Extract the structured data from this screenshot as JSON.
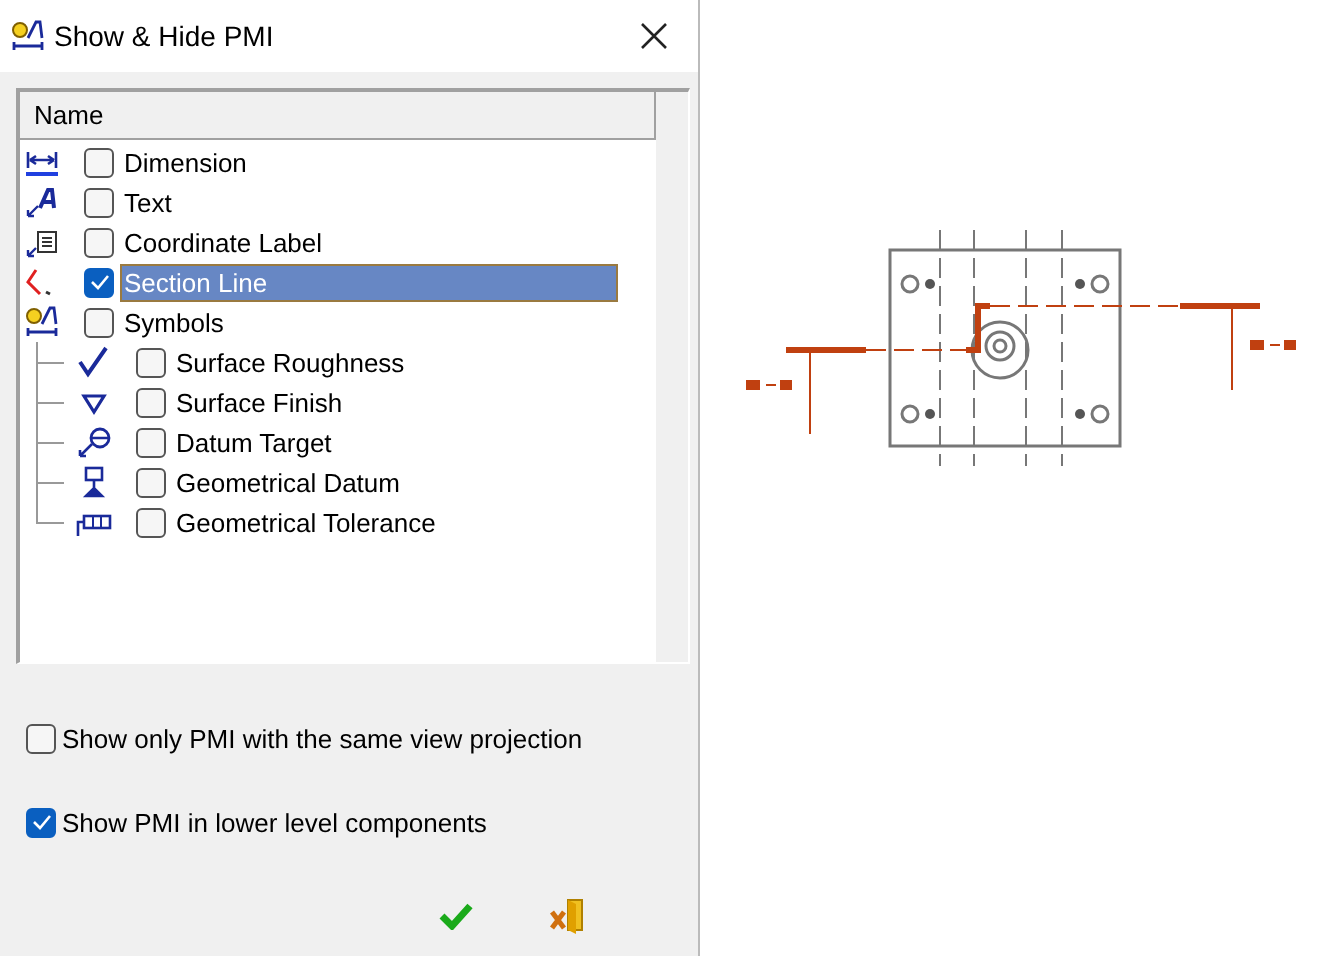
{
  "window": {
    "title": "Show & Hide PMI"
  },
  "tree": {
    "column": "Name",
    "items": [
      {
        "kind": "dimension",
        "label": "Dimension",
        "checked": false,
        "selected": false
      },
      {
        "kind": "text",
        "label": "Text",
        "checked": false,
        "selected": false
      },
      {
        "kind": "coordinate",
        "label": "Coordinate Label",
        "checked": false,
        "selected": false
      },
      {
        "kind": "section",
        "label": "Section Line",
        "checked": true,
        "selected": true
      },
      {
        "kind": "symbols",
        "label": "Symbols",
        "checked": false,
        "selected": false,
        "children": [
          {
            "kind": "roughness",
            "label": "Surface Roughness",
            "checked": false,
            "selected": false
          },
          {
            "kind": "finish",
            "label": "Surface Finish",
            "checked": false,
            "selected": false
          },
          {
            "kind": "target",
            "label": "Datum Target",
            "checked": false,
            "selected": false
          },
          {
            "kind": "datum",
            "label": "Geometrical Datum",
            "checked": false,
            "selected": false
          },
          {
            "kind": "tolerance",
            "label": "Geometrical Tolerance",
            "checked": false,
            "selected": false
          }
        ]
      }
    ]
  },
  "options": [
    {
      "label": "Show only PMI with the same view projection",
      "checked": false
    },
    {
      "label": "Show PMI in lower level components",
      "checked": true
    }
  ]
}
